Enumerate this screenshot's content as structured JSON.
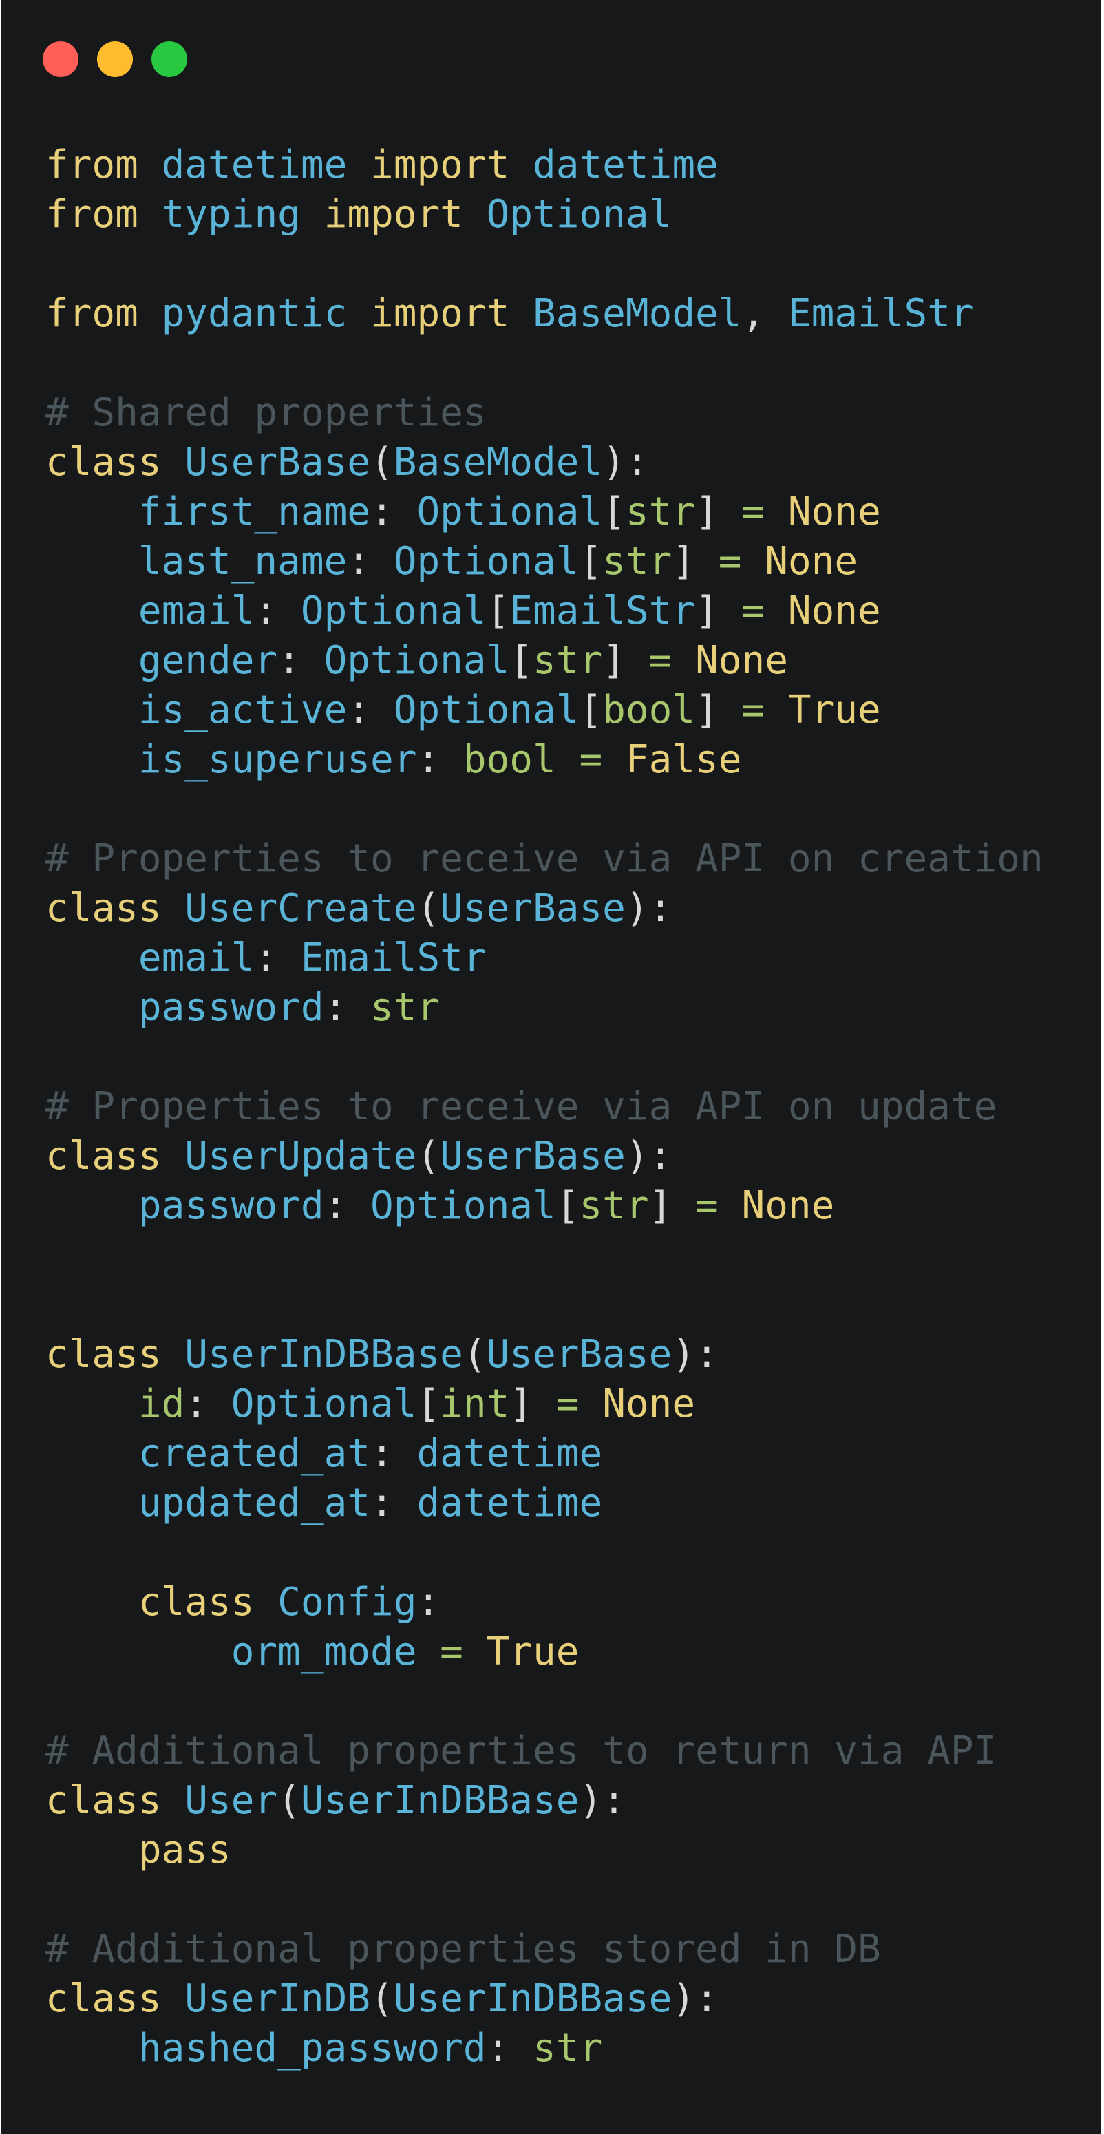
{
  "window": {
    "controls": [
      {
        "name": "close-dot",
        "color": "#ff5f57"
      },
      {
        "name": "minimize-dot",
        "color": "#febc2e"
      },
      {
        "name": "zoom-dot",
        "color": "#28c840"
      }
    ]
  },
  "code": {
    "language": "python",
    "lines": [
      [
        [
          "keyword",
          "from"
        ],
        [
          "ws",
          " "
        ],
        [
          "ident",
          "datetime"
        ],
        [
          "ws",
          " "
        ],
        [
          "keyword",
          "import"
        ],
        [
          "ws",
          " "
        ],
        [
          "ident",
          "datetime"
        ]
      ],
      [
        [
          "keyword",
          "from"
        ],
        [
          "ws",
          " "
        ],
        [
          "ident",
          "typing"
        ],
        [
          "ws",
          " "
        ],
        [
          "keyword",
          "import"
        ],
        [
          "ws",
          " "
        ],
        [
          "ident",
          "Optional"
        ]
      ],
      [],
      [
        [
          "keyword",
          "from"
        ],
        [
          "ws",
          " "
        ],
        [
          "ident",
          "pydantic"
        ],
        [
          "ws",
          " "
        ],
        [
          "keyword",
          "import"
        ],
        [
          "ws",
          " "
        ],
        [
          "ident",
          "BaseModel"
        ],
        [
          "punct",
          ", "
        ],
        [
          "ident",
          "EmailStr"
        ]
      ],
      [],
      [
        [
          "comment",
          "# Shared properties"
        ]
      ],
      [
        [
          "keyword",
          "class"
        ],
        [
          "ws",
          " "
        ],
        [
          "ident",
          "UserBase"
        ],
        [
          "punct",
          "("
        ],
        [
          "ident",
          "BaseModel"
        ],
        [
          "punct",
          "):"
        ]
      ],
      [
        [
          "ws",
          "    "
        ],
        [
          "ident",
          "first_name"
        ],
        [
          "punct",
          ": "
        ],
        [
          "ident",
          "Optional"
        ],
        [
          "punct",
          "["
        ],
        [
          "builtin",
          "str"
        ],
        [
          "punct",
          "]"
        ],
        [
          "ws",
          " "
        ],
        [
          "op",
          "="
        ],
        [
          "ws",
          " "
        ],
        [
          "const",
          "None"
        ]
      ],
      [
        [
          "ws",
          "    "
        ],
        [
          "ident",
          "last_name"
        ],
        [
          "punct",
          ": "
        ],
        [
          "ident",
          "Optional"
        ],
        [
          "punct",
          "["
        ],
        [
          "builtin",
          "str"
        ],
        [
          "punct",
          "]"
        ],
        [
          "ws",
          " "
        ],
        [
          "op",
          "="
        ],
        [
          "ws",
          " "
        ],
        [
          "const",
          "None"
        ]
      ],
      [
        [
          "ws",
          "    "
        ],
        [
          "ident",
          "email"
        ],
        [
          "punct",
          ": "
        ],
        [
          "ident",
          "Optional"
        ],
        [
          "punct",
          "["
        ],
        [
          "ident",
          "EmailStr"
        ],
        [
          "punct",
          "]"
        ],
        [
          "ws",
          " "
        ],
        [
          "op",
          "="
        ],
        [
          "ws",
          " "
        ],
        [
          "const",
          "None"
        ]
      ],
      [
        [
          "ws",
          "    "
        ],
        [
          "ident",
          "gender"
        ],
        [
          "punct",
          ": "
        ],
        [
          "ident",
          "Optional"
        ],
        [
          "punct",
          "["
        ],
        [
          "builtin",
          "str"
        ],
        [
          "punct",
          "]"
        ],
        [
          "ws",
          " "
        ],
        [
          "op",
          "="
        ],
        [
          "ws",
          " "
        ],
        [
          "const",
          "None"
        ]
      ],
      [
        [
          "ws",
          "    "
        ],
        [
          "ident",
          "is_active"
        ],
        [
          "punct",
          ": "
        ],
        [
          "ident",
          "Optional"
        ],
        [
          "punct",
          "["
        ],
        [
          "builtin",
          "bool"
        ],
        [
          "punct",
          "]"
        ],
        [
          "ws",
          " "
        ],
        [
          "op",
          "="
        ],
        [
          "ws",
          " "
        ],
        [
          "const",
          "True"
        ]
      ],
      [
        [
          "ws",
          "    "
        ],
        [
          "ident",
          "is_superuser"
        ],
        [
          "punct",
          ": "
        ],
        [
          "builtin",
          "bool"
        ],
        [
          "ws",
          " "
        ],
        [
          "op",
          "="
        ],
        [
          "ws",
          " "
        ],
        [
          "const",
          "False"
        ]
      ],
      [],
      [
        [
          "comment",
          "# Properties to receive via API on creation"
        ]
      ],
      [
        [
          "keyword",
          "class"
        ],
        [
          "ws",
          " "
        ],
        [
          "ident",
          "UserCreate"
        ],
        [
          "punct",
          "("
        ],
        [
          "ident",
          "UserBase"
        ],
        [
          "punct",
          "):"
        ]
      ],
      [
        [
          "ws",
          "    "
        ],
        [
          "ident",
          "email"
        ],
        [
          "punct",
          ": "
        ],
        [
          "ident",
          "EmailStr"
        ]
      ],
      [
        [
          "ws",
          "    "
        ],
        [
          "ident",
          "password"
        ],
        [
          "punct",
          ": "
        ],
        [
          "builtin",
          "str"
        ]
      ],
      [],
      [
        [
          "comment",
          "# Properties to receive via API on update"
        ]
      ],
      [
        [
          "keyword",
          "class"
        ],
        [
          "ws",
          " "
        ],
        [
          "ident",
          "UserUpdate"
        ],
        [
          "punct",
          "("
        ],
        [
          "ident",
          "UserBase"
        ],
        [
          "punct",
          "):"
        ]
      ],
      [
        [
          "ws",
          "    "
        ],
        [
          "ident",
          "password"
        ],
        [
          "punct",
          ": "
        ],
        [
          "ident",
          "Optional"
        ],
        [
          "punct",
          "["
        ],
        [
          "builtin",
          "str"
        ],
        [
          "punct",
          "]"
        ],
        [
          "ws",
          " "
        ],
        [
          "op",
          "="
        ],
        [
          "ws",
          " "
        ],
        [
          "const",
          "None"
        ]
      ],
      [],
      [],
      [
        [
          "keyword",
          "class"
        ],
        [
          "ws",
          " "
        ],
        [
          "ident",
          "UserInDBBase"
        ],
        [
          "punct",
          "("
        ],
        [
          "ident",
          "UserBase"
        ],
        [
          "punct",
          "):"
        ]
      ],
      [
        [
          "ws",
          "    "
        ],
        [
          "builtin",
          "id"
        ],
        [
          "punct",
          ": "
        ],
        [
          "ident",
          "Optional"
        ],
        [
          "punct",
          "["
        ],
        [
          "builtin",
          "int"
        ],
        [
          "punct",
          "]"
        ],
        [
          "ws",
          " "
        ],
        [
          "op",
          "="
        ],
        [
          "ws",
          " "
        ],
        [
          "const",
          "None"
        ]
      ],
      [
        [
          "ws",
          "    "
        ],
        [
          "ident",
          "created_at"
        ],
        [
          "punct",
          ": "
        ],
        [
          "ident",
          "datetime"
        ]
      ],
      [
        [
          "ws",
          "    "
        ],
        [
          "ident",
          "updated_at"
        ],
        [
          "punct",
          ": "
        ],
        [
          "ident",
          "datetime"
        ]
      ],
      [],
      [
        [
          "ws",
          "    "
        ],
        [
          "keyword",
          "class"
        ],
        [
          "ws",
          " "
        ],
        [
          "ident",
          "Config"
        ],
        [
          "punct",
          ":"
        ]
      ],
      [
        [
          "ws",
          "        "
        ],
        [
          "ident",
          "orm_mode"
        ],
        [
          "ws",
          " "
        ],
        [
          "op",
          "="
        ],
        [
          "ws",
          " "
        ],
        [
          "const",
          "True"
        ]
      ],
      [],
      [
        [
          "comment",
          "# Additional properties to return via API"
        ]
      ],
      [
        [
          "keyword",
          "class"
        ],
        [
          "ws",
          " "
        ],
        [
          "ident",
          "User"
        ],
        [
          "punct",
          "("
        ],
        [
          "ident",
          "UserInDBBase"
        ],
        [
          "punct",
          "):"
        ]
      ],
      [
        [
          "ws",
          "    "
        ],
        [
          "keyword",
          "pass"
        ]
      ],
      [],
      [
        [
          "comment",
          "# Additional properties stored in DB"
        ]
      ],
      [
        [
          "keyword",
          "class"
        ],
        [
          "ws",
          " "
        ],
        [
          "ident",
          "UserInDB"
        ],
        [
          "punct",
          "("
        ],
        [
          "ident",
          "UserInDBBase"
        ],
        [
          "punct",
          "):"
        ]
      ],
      [
        [
          "ws",
          "    "
        ],
        [
          "ident",
          "hashed_password"
        ],
        [
          "punct",
          ": "
        ],
        [
          "builtin",
          "str"
        ]
      ]
    ]
  }
}
